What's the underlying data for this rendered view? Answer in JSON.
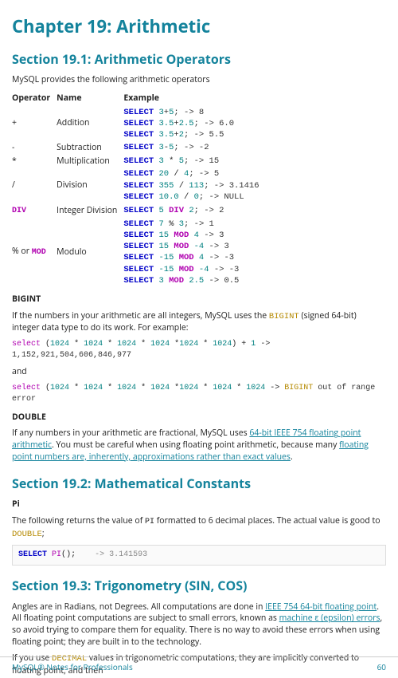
{
  "chapter_title": "Chapter 19: Arithmetic",
  "section_1": {
    "heading": "Section 19.1: Arithmetic Operators",
    "intro": "MySQL provides the following arithmetic operators",
    "table": {
      "headers": [
        "Operator",
        "Name",
        "Example"
      ],
      "rows": {
        "add_op": "+",
        "add_name": "Addition",
        "sub_op": "-",
        "sub_name": "Subtraction",
        "mul_op": "*",
        "mul_name": "Multiplication",
        "div_op": "/",
        "div_name": "Division",
        "idiv_name": "Integer Division",
        "mod_op_prefix": "% or ",
        "mod_name": "Modulo"
      }
    },
    "bigint_head": "BIGINT",
    "bigint_p1a": "If the numbers in your arithmetic are all integers, MySQL uses the ",
    "bigint_kw": "BIGINT",
    "bigint_p1b": " (signed 64-bit) integer data type to do its work. For example:",
    "ex1_result": " -> 1,152,921,504,606,846,977",
    "and": "and",
    "ex2_suffix": " out of range error",
    "double_head": "DOUBLE",
    "double_p1a": "If any numbers in your arithmetic are fractional, MySQL uses ",
    "double_link1": "64-bit IEEE 754 floating point arithmetic",
    "double_p1b": ". You must be careful when using floating point arithmetic, because many ",
    "double_link2": "floating point numbers are, inherently, approximations rather than exact values",
    "double_p1c": "."
  },
  "section_2": {
    "heading": "Section 19.2: Mathematical Constants",
    "pi_head": "Pi",
    "pi_p_a": "The following returns the value of ",
    "pi_kw1": "PI",
    "pi_p_b": " formatted to 6 decimal places. The actual value is good to ",
    "pi_kw2": "DOUBLE",
    "pi_p_c": ";",
    "codebox": {
      "result": "-> 3.141593"
    }
  },
  "section_3": {
    "heading": "Section 19.3: Trigonometry (SIN, COS)",
    "p1a": "Angles are in Radians, not Degrees. All computations are done in ",
    "p1_link1": "IEEE 754 64-bit floating point",
    "p1b": ". All floating point computations are subject to small errors, known as ",
    "p1_link2": "machine ε (epsilon) errors",
    "p1c": ", so avoid trying to compare them for equality. There is no way to avoid these errors when using floating point; they are built in to the technology.",
    "p2a": "If you use ",
    "p2_kw": "DECIMAL",
    "p2b": " values in trigonometric computations, they are implicitly converted to floating point, and then"
  },
  "footer": {
    "left": "MySQL® Notes for Professionals",
    "right": "60"
  },
  "tok": {
    "select": "select",
    "SELECT": "SELECT",
    "DIV": "DIV",
    "MOD": "MOD",
    "PI": "PI",
    "BIGINT": "BIGINT",
    "n3": "3",
    "n5": "5",
    "n3_5": "3.5",
    "n2_5": "2.5",
    "n2": "2",
    "n20": "20",
    "n4": "4",
    "n355": "355",
    "n113": "113",
    "n10_0": "10.0",
    "n0": "0",
    "n7": "7",
    "n15": "15",
    "nm15": "-15",
    "nm4": "-4",
    "n1024": "1024",
    "n1": "1",
    "r8": "; -> 8",
    "r6_0": "; -> 6.0",
    "r5_5": "; -> 5.5",
    "rm2": "; -> -2",
    "r15": "; -> 15",
    "r5": "; -> 5",
    "r31416": "; -> 3.1416",
    "rNULL": "; -> NULL",
    "r2": "; -> 2",
    "r1": "; -> 1",
    "r3": " -> 3",
    "rm3": " -> -3",
    "r0_5": " -> 0.5",
    "plus": "+",
    "minus": "-",
    "star": " * ",
    "slash": " / ",
    "sp": " ",
    "lp": "(",
    "rp": ")",
    "semi": ";",
    "pct": "%"
  }
}
